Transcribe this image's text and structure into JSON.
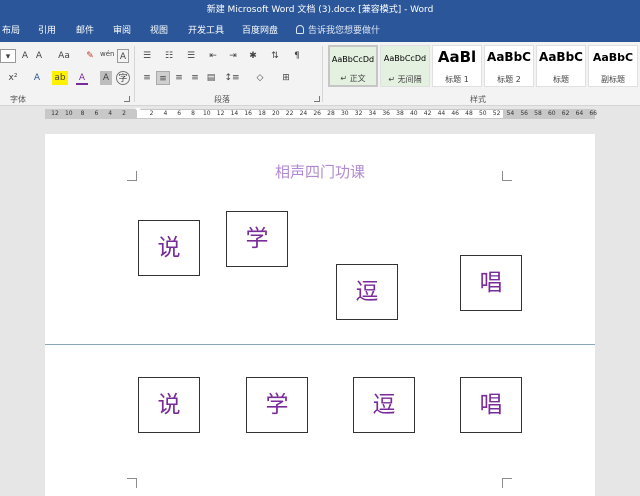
{
  "window": {
    "title": "新建 Microsoft Word 文档 (3).docx [兼容模式] - Word"
  },
  "menu": {
    "tabs": [
      "布局",
      "引用",
      "邮件",
      "审阅",
      "视图",
      "开发工具",
      "百度网盘"
    ],
    "tell_me": "告诉我您想要做什"
  },
  "ribbon": {
    "font_group_label": "字体",
    "paragraph_group_label": "段落",
    "styles_group_label": "样式",
    "font_buttons": {
      "aa": "Aa",
      "wen": "wén",
      "a_box": "A",
      "x2": "x²",
      "a_text": "A",
      "ab": "ab",
      "a_red": "A",
      "a_shade": "A",
      "circle_zi": "字"
    },
    "styles": [
      {
        "sample": "AaBbCcDd",
        "name": "↵ 正文"
      },
      {
        "sample": "AaBbCcDd",
        "name": "↵ 无间隔"
      },
      {
        "sample": "AaBl",
        "name": "标题 1"
      },
      {
        "sample": "AaBbC",
        "name": "标题 2"
      },
      {
        "sample": "AaBbC",
        "name": "标题"
      },
      {
        "sample": "AaBbC",
        "name": "副标题"
      }
    ]
  },
  "ruler": {
    "ticks": [
      "12",
      "10",
      "8",
      "6",
      "4",
      "2",
      "",
      "2",
      "4",
      "6",
      "8",
      "10",
      "12",
      "14",
      "16",
      "18",
      "20",
      "22",
      "24",
      "26",
      "28",
      "30",
      "32",
      "34",
      "36",
      "38",
      "40",
      "42",
      "44",
      "46",
      "48",
      "50",
      "52",
      "54",
      "56",
      "58",
      "60",
      "62",
      "64",
      "66"
    ]
  },
  "document": {
    "title": "相声四门功课",
    "page1_chars": [
      "说",
      "学",
      "逗",
      "唱"
    ],
    "page2_chars": [
      "说",
      "学",
      "逗",
      "唱"
    ]
  },
  "colors": {
    "accent": "#2b579a",
    "title_text": "#b08ad0",
    "char_text": "#7a2b9a"
  }
}
